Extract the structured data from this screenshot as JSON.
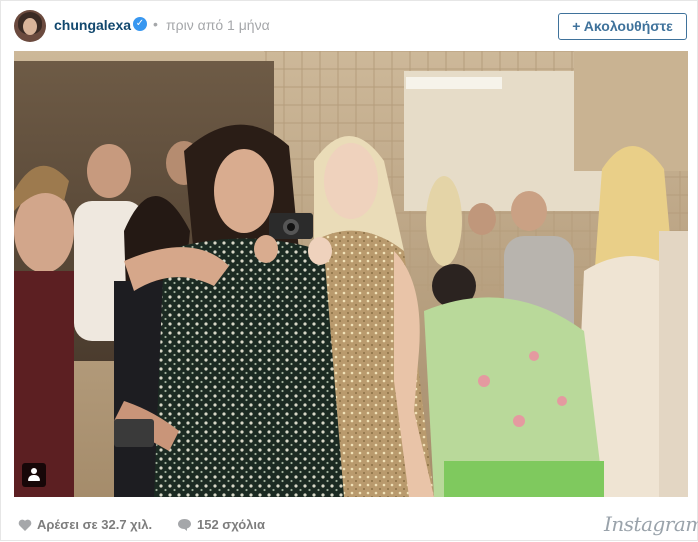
{
  "post": {
    "username": "chungalexa",
    "verified_icon": "verified-badge-icon",
    "separator": "•",
    "time_ago": "πριν από 1 μήνα",
    "follow_label": "+ Ακολουθήστε"
  },
  "footer": {
    "likes_label": "Αρέσει σε 32.7 χιλ.",
    "comments_label": "152 σχόλια",
    "brand": "Instagram"
  },
  "colors": {
    "username": "#12486e",
    "follow_border": "#3f729b",
    "muted": "#a5a7aa",
    "verified": "#3897f0"
  }
}
